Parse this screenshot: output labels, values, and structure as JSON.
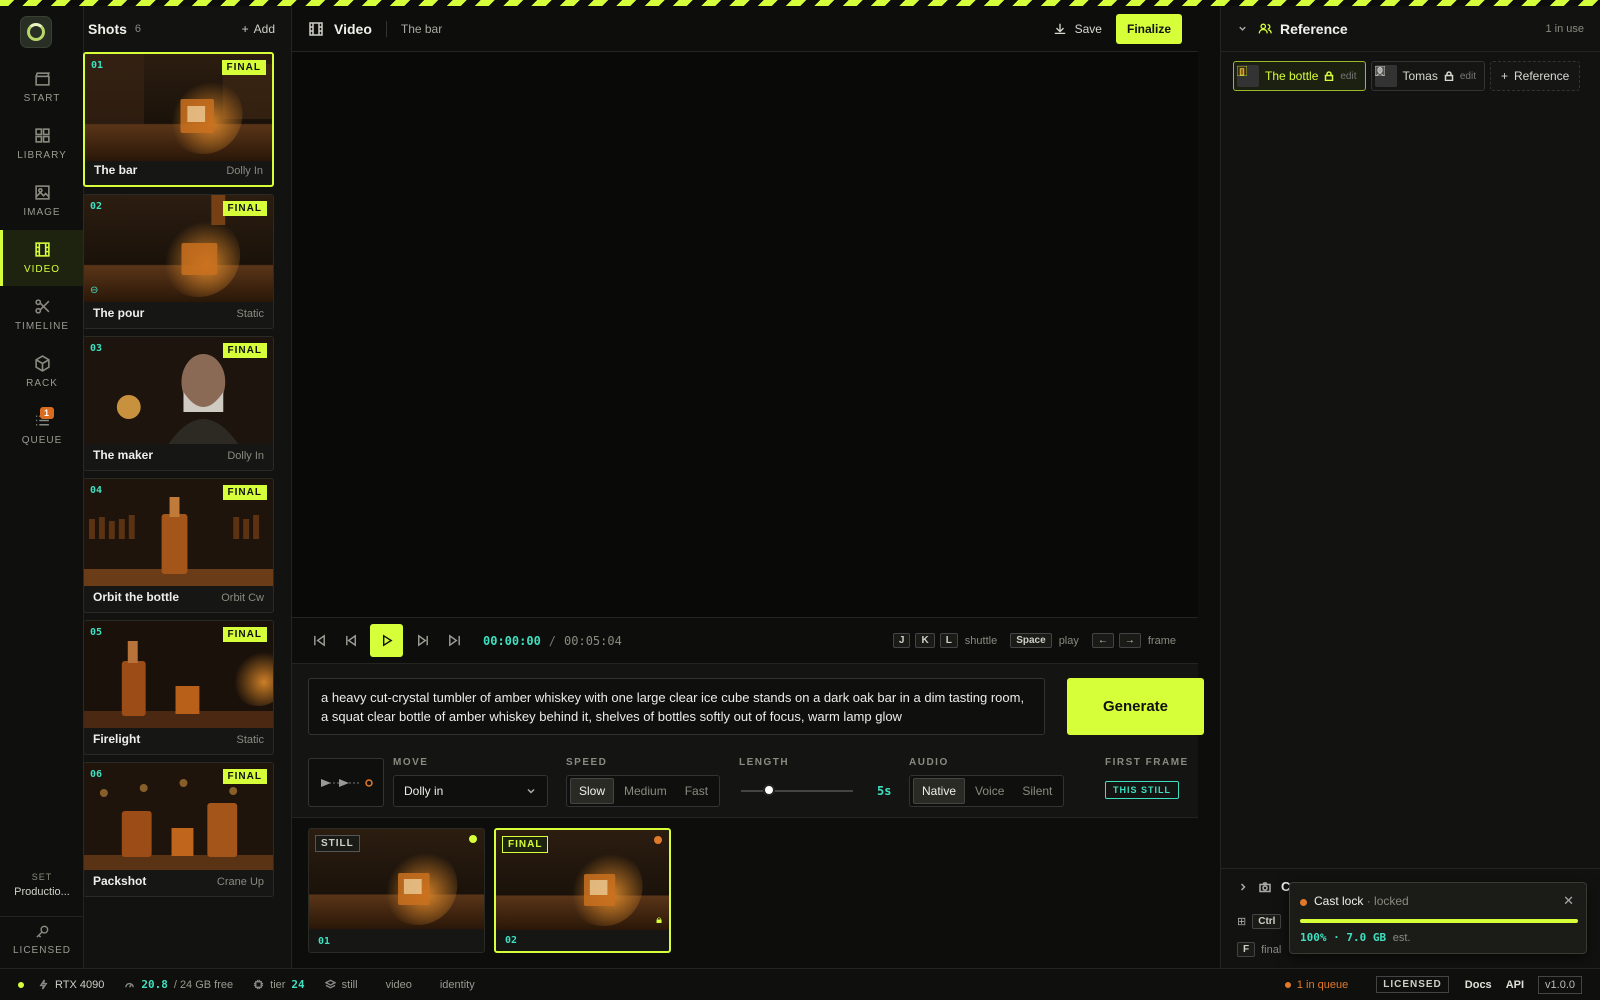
{
  "rail": {
    "items": [
      {
        "label": "START",
        "icon": "clapper-icon"
      },
      {
        "label": "LIBRARY",
        "icon": "grid-icon"
      },
      {
        "label": "IMAGE",
        "icon": "image-icon"
      },
      {
        "label": "VIDEO",
        "icon": "film-icon",
        "active": true
      },
      {
        "label": "TIMELINE",
        "icon": "scissors-icon"
      },
      {
        "label": "RACK",
        "icon": "cube-icon"
      },
      {
        "label": "QUEUE",
        "icon": "list-icon",
        "badge": "1"
      }
    ],
    "set_label": "SET",
    "set_value": "Productio...",
    "licensed": "LICENSED"
  },
  "shots": {
    "title": "Shots",
    "count": "6",
    "add_label": "Add",
    "items": [
      {
        "num": "01",
        "status": "FINAL",
        "name": "The bar",
        "move": "Dolly In"
      },
      {
        "num": "02",
        "status": "FINAL",
        "name": "The pour",
        "move": "Static"
      },
      {
        "num": "03",
        "status": "FINAL",
        "name": "The maker",
        "move": "Dolly In"
      },
      {
        "num": "04",
        "status": "FINAL",
        "name": "Orbit the bottle",
        "move": "Orbit Cw"
      },
      {
        "num": "05",
        "status": "FINAL",
        "name": "Firelight",
        "move": "Static"
      },
      {
        "num": "06",
        "status": "FINAL",
        "name": "Packshot",
        "move": "Crane Up"
      }
    ]
  },
  "header": {
    "title": "Video",
    "subtitle": "The bar",
    "save_label": "Save",
    "finalize_label": "Finalize"
  },
  "transport": {
    "current": "00:00:00",
    "separator": "/",
    "total": "00:05:04",
    "keys": {
      "j": "J",
      "k": "K",
      "l": "L",
      "shuttle": "shuttle",
      "space": "Space",
      "play": "play",
      "left": "←",
      "right": "→",
      "frame": "frame"
    }
  },
  "prompt": {
    "text": "a heavy cut-crystal tumbler of amber whiskey with one large clear ice cube stands on a dark oak bar in a dim tasting room, a squat clear bottle of amber whiskey behind it, shelves of bottles softly out of focus, warm lamp glow",
    "generate_label": "Generate"
  },
  "options": {
    "move_label": "MOVE",
    "move_value": "Dolly in",
    "speed_label": "SPEED",
    "speed_options": [
      "Slow",
      "Medium",
      "Fast"
    ],
    "speed_selected": "Slow",
    "length_label": "LENGTH",
    "length_value": "5s",
    "length_fraction": 0.25,
    "audio_label": "AUDIO",
    "audio_options": [
      "Native",
      "Voice",
      "Silent"
    ],
    "audio_selected": "Native",
    "first_frame_label": "FIRST FRAME",
    "first_frame_value": "THIS STILL"
  },
  "takes": [
    {
      "tag": "STILL",
      "num": "01",
      "dot_color": "#d6ff3a"
    },
    {
      "tag": "FINAL",
      "num": "02",
      "dot_color": "#e07a2a",
      "locked": true
    }
  ],
  "reference": {
    "title": "Reference",
    "in_use": "1 in use",
    "chips": [
      {
        "label": "The bottle",
        "edit": "edit",
        "active": true
      },
      {
        "label": "Tomas",
        "edit": "edit"
      }
    ],
    "add_label": "Reference",
    "section2_title": "C",
    "ctrl_key": "Ctrl",
    "f_key": "F",
    "f_label": "final"
  },
  "toast": {
    "title": "Cast lock",
    "state": "· locked",
    "progress": "100% · 7.0 GB",
    "est": "est."
  },
  "status": {
    "gpu": "RTX 4090",
    "vram_free": "20.8",
    "vram_total": "/ 24 GB free",
    "tier_label": "tier",
    "tier_value": "24",
    "mode_still": "still",
    "mode_video": "video",
    "mode_identity": "identity",
    "queue": "1 in queue",
    "license": "LICENSED",
    "docs": "Docs",
    "api": "API",
    "version": "v1.0.0"
  },
  "colors": {
    "accent": "#d6ff3a",
    "teal": "#3ee0c0",
    "orange": "#e07a2a"
  }
}
